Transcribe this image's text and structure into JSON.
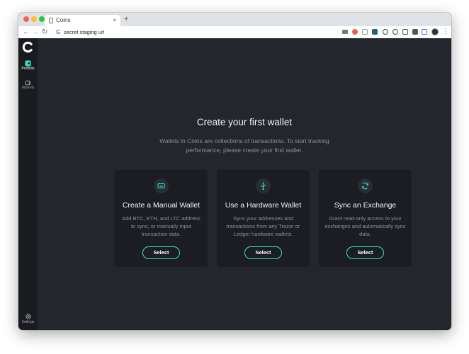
{
  "browser": {
    "tab_title": "Coins",
    "tab_close": "×",
    "new_tab": "+",
    "url": "secret staging url",
    "back_icon": "←",
    "forward_icon": "→",
    "reload_icon": "↻",
    "menu_icon": "⋮"
  },
  "sidebar": {
    "items": [
      {
        "label": "Portfolio",
        "icon": "wallet-icon",
        "active": true
      },
      {
        "label": "Markets",
        "icon": "markets-icon",
        "active": false
      },
      {
        "label": "Settings",
        "icon": "gear-icon",
        "active": false
      }
    ]
  },
  "main": {
    "heading": "Create your first wallet",
    "intro": "Wallets in Coins are collections of transactions. To start tracking performance, please create your first wallet.",
    "cards": [
      {
        "title": "Create a Manual Wallet",
        "description": "Add BTC, ETH, and LTC address to sync, or manually input transaction data.",
        "button": "Select",
        "icon": "keyboard-icon"
      },
      {
        "title": "Use a Hardware Wallet",
        "description": "Sync your addresses and transactions from any Trezor or Ledger hardware wallets.",
        "button": "Select",
        "icon": "usb-icon"
      },
      {
        "title": "Sync an Exchange",
        "description": "Grant read-only access to your exchanges and automatically sync data.",
        "button": "Select",
        "icon": "sync-icon"
      }
    ]
  },
  "colors": {
    "accent": "#2ee6c8",
    "background": "#24262d",
    "sidebar": "#1a1b1f",
    "card": "#1c1d22"
  }
}
